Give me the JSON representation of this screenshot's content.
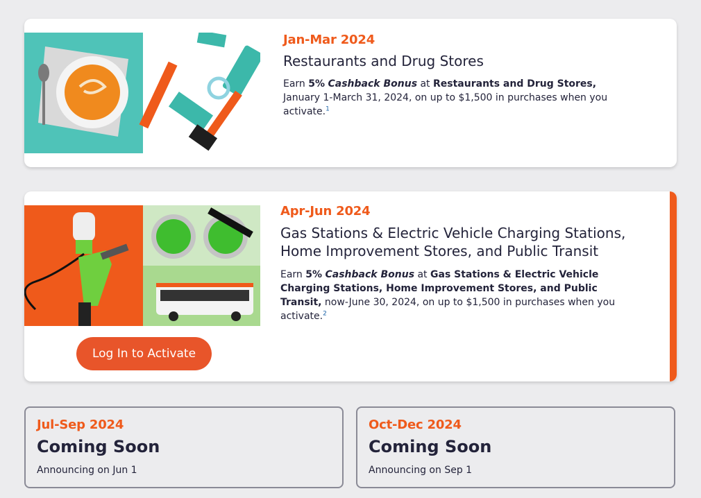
{
  "offers": [
    {
      "period": "Jan-Mar 2024",
      "title": "Restaurants and Drug Stores",
      "body": {
        "earn": "Earn ",
        "pct": "5%",
        "bonus": "Cashback Bonus",
        "at": " at ",
        "categories": "Restaurants and Drug Stores,",
        "rest": " January 1-March 31, 2024, on up to $1,500 in purchases when you activate.",
        "footnote": "1"
      }
    },
    {
      "period": "Apr-Jun 2024",
      "title_line1": "Gas Stations & Electric Vehicle Charging Stations,",
      "title_line2": "Home Improvement Stores, and Public Transit",
      "body": {
        "earn": "Earn ",
        "pct": "5%",
        "bonus": "Cashback Bonus",
        "at": " at ",
        "categories": "Gas Stations & Electric Vehicle Charging Stations, Home Improvement Stores, and Public Transit,",
        "rest": " now-June 30, 2024, on up to $1,500 in purchases when you activate.",
        "footnote": "2"
      },
      "button_label": "Log In to Activate"
    }
  ],
  "upcoming": [
    {
      "period": "Jul-Sep 2024",
      "headline": "Coming Soon",
      "announce": "Announcing on Jun 1"
    },
    {
      "period": "Oct-Dec 2024",
      "headline": "Coming Soon",
      "announce": "Announcing on Sep 1"
    }
  ],
  "colors": {
    "accent": "#ef5a1b",
    "button": "#e8552a",
    "text": "#23233a",
    "teal": "#4fc3b8",
    "green": "#6fcf3f"
  }
}
